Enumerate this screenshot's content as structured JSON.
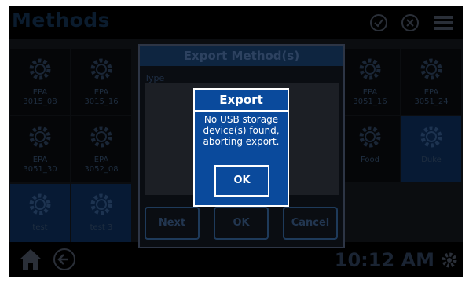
{
  "header": {
    "title": "Methods"
  },
  "tiles": [
    {
      "label": "EPA\n3015_08"
    },
    {
      "label": "EPA\n3015_16"
    },
    {
      "label": "EPA\n3051_16"
    },
    {
      "label": "EPA\n3051_24"
    },
    {
      "label": "EPA\n3051_30"
    },
    {
      "label": "EPA\n3052_08"
    },
    {
      "label": "Food"
    },
    {
      "label": "Duke"
    },
    {
      "label": "test"
    },
    {
      "label": "test 3"
    }
  ],
  "export_method_dialog": {
    "title": "Export Method(s)",
    "type_label": "Type",
    "buttons": {
      "next": "Next",
      "ok": "OK",
      "cancel": "Cancel"
    }
  },
  "export_popup": {
    "title": "Export",
    "message": "No USB storage device(s) found, aborting export.",
    "ok": "OK"
  },
  "statusbar": {
    "time": "10:12 AM"
  },
  "colors": {
    "accent": "#0a4a9c",
    "popup_border": "#ffffff"
  }
}
